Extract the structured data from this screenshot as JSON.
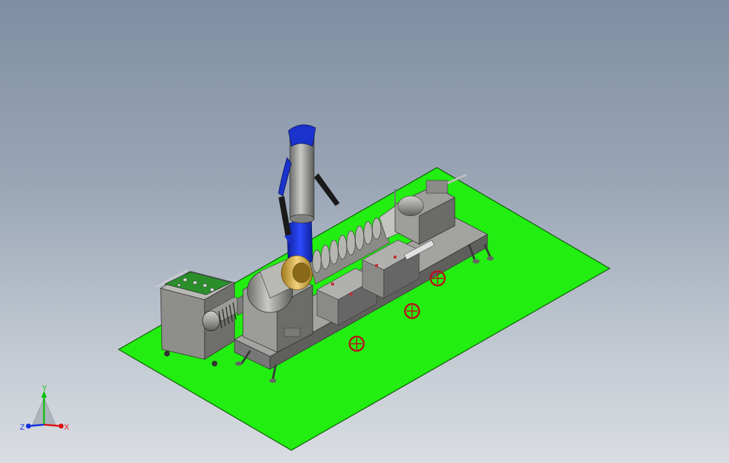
{
  "viewport": {
    "background_top": "#7f8ea3",
    "background_bottom": "#d9dde2"
  },
  "colors": {
    "floor": "#22ee11",
    "machine_gray": "#8c8c8a",
    "machine_dark": "#5a5a58",
    "arm_blue": "#1a33cc",
    "arm_black": "#1a1a1a",
    "ring_gold": "#d4b04a",
    "wheel_red": "#b8121b",
    "panel_green": "#1f8a1f",
    "axis_x": "#e01010",
    "axis_y": "#10c010",
    "axis_z": "#1030e0"
  },
  "triad": {
    "x_label": "X",
    "y_label": "Y",
    "z_label": "Z"
  }
}
